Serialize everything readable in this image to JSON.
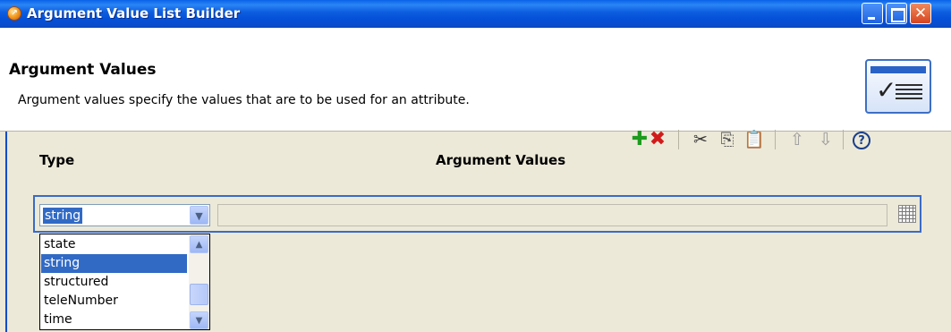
{
  "window": {
    "title": "Argument Value List Builder",
    "buttons": {
      "minimize": "_",
      "maximize": "",
      "close": "✕"
    }
  },
  "header": {
    "title": "Argument Values",
    "description": "Argument values specify the values that are to be used for an attribute."
  },
  "columns": {
    "type": "Type",
    "argument_values": "Argument Values"
  },
  "toolbar": {
    "add_icon": "✚",
    "delete_icon": "✖",
    "cut_icon": "✂",
    "copy_icon": "⎘",
    "paste_icon": "📋",
    "up_icon": "⇧",
    "down_icon": "⇩",
    "help_icon": "?"
  },
  "row": {
    "type_value": "string",
    "argument_value": ""
  },
  "dropdown": {
    "options": [
      "state",
      "string",
      "structured",
      "teleNumber",
      "time"
    ],
    "selected": "string"
  }
}
